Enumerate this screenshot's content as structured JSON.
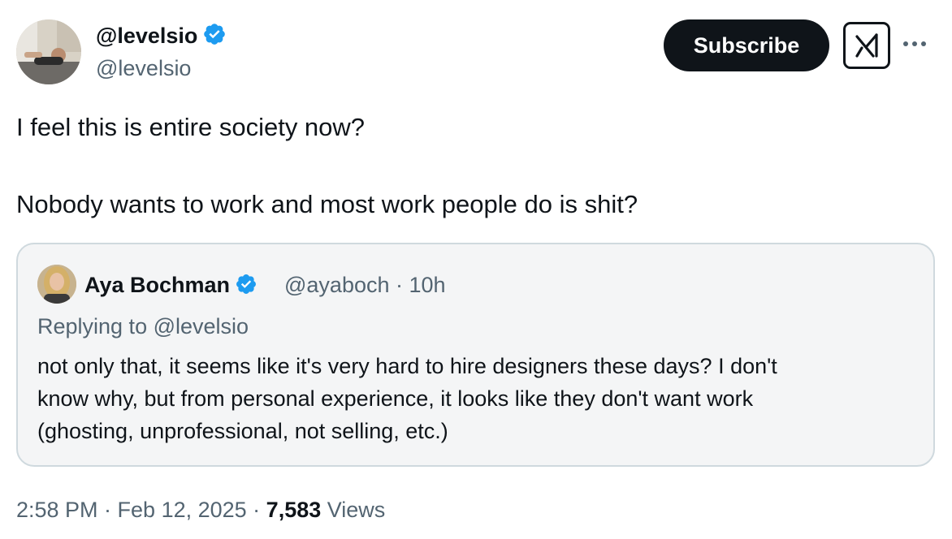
{
  "author": {
    "display_name": "@levelsio",
    "handle": "@levelsio",
    "verified_color": "#1d9bf0"
  },
  "header": {
    "subscribe_label": "Subscribe",
    "grok_icon": "grok-icon",
    "more_icon": "more-horizontal-icon"
  },
  "tweet": {
    "lines": [
      "I feel this is entire society now?",
      "Nobody wants to work and most work people do is shit?"
    ]
  },
  "quote": {
    "display_name": "Aya Bochman",
    "handle_time": "@ayaboch · 10h",
    "replying_to": "Replying to @levelsio",
    "text": "not only that, it seems like it's very hard to hire designers these days? I don't\nknow why, but from personal experience, it looks like they don't want work\n(ghosting, unprofessional, not selling, etc.)"
  },
  "meta": {
    "time_date": "2:58 PM · Feb 12, 2025 · ",
    "views_count": "7,583",
    "views_label": " Views"
  }
}
